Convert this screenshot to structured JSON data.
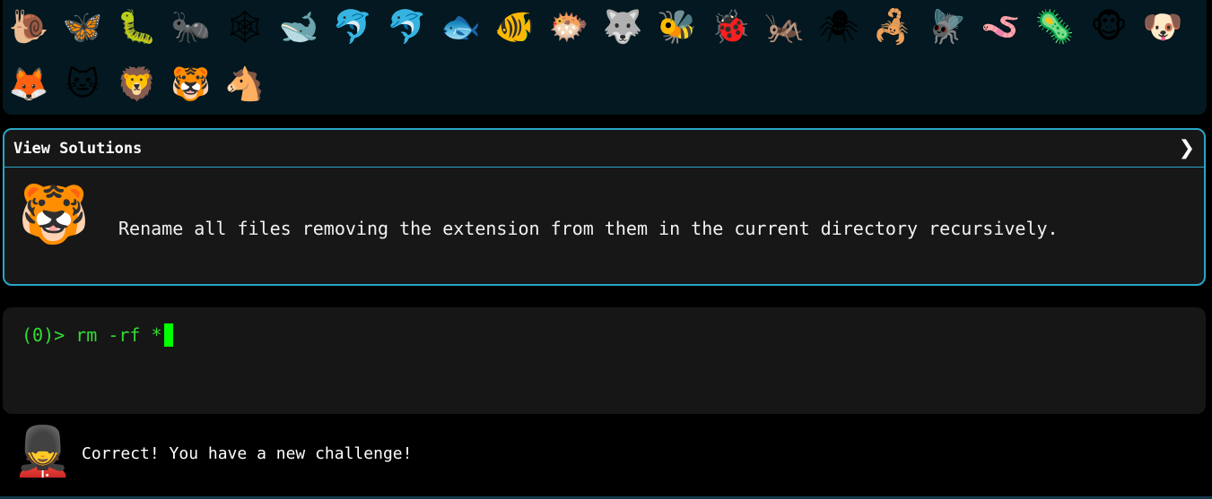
{
  "emoji_bar": {
    "row1": [
      {
        "glyph": "🐌",
        "name": "snail-icon"
      },
      {
        "glyph": "🦋",
        "name": "butterfly-icon"
      },
      {
        "glyph": "🐛",
        "name": "caterpillar-icon"
      },
      {
        "glyph": "🐜",
        "name": "ant-icon"
      },
      {
        "glyph": "🕸",
        "name": "spider-web-icon"
      },
      {
        "glyph": "🐋",
        "name": "whale-icon"
      },
      {
        "glyph": "🐬",
        "name": "dolphin-icon"
      },
      {
        "glyph": "🐬",
        "name": "dolphin-gray-icon"
      },
      {
        "glyph": "🐟",
        "name": "fish-icon"
      },
      {
        "glyph": "🐠",
        "name": "tropical-fish-icon"
      },
      {
        "glyph": "🐡",
        "name": "blowfish-icon"
      },
      {
        "glyph": "🐺",
        "name": "wolf-icon"
      },
      {
        "glyph": "🐝",
        "name": "bee-icon"
      },
      {
        "glyph": "🐞",
        "name": "ladybug-icon"
      },
      {
        "glyph": "🦗",
        "name": "cricket-icon"
      },
      {
        "glyph": "🕷",
        "name": "spider-icon"
      },
      {
        "glyph": "🦂",
        "name": "scorpion-icon"
      },
      {
        "glyph": "🪰",
        "name": "fly-icon"
      },
      {
        "glyph": "🪱",
        "name": "worm-icon"
      },
      {
        "glyph": "🦠",
        "name": "microbe-icon"
      },
      {
        "glyph": "🐵",
        "name": "monkey-icon"
      },
      {
        "glyph": "🐶",
        "name": "dog-icon"
      }
    ],
    "row2": [
      {
        "glyph": "🦊",
        "name": "fox-icon"
      },
      {
        "glyph": "🐱",
        "name": "cat-icon"
      },
      {
        "glyph": "🦁",
        "name": "lion-icon"
      },
      {
        "glyph": "🐯",
        "name": "tiger-icon"
      },
      {
        "glyph": "🐴",
        "name": "horse-icon"
      }
    ]
  },
  "solutions": {
    "title": "View Solutions",
    "chevron": "❯",
    "challenge_icon": "🐯",
    "challenge_text": "Rename all files removing the extension from them in the current directory recursively."
  },
  "terminal": {
    "prompt": "(0)> ",
    "command": "rm -rf *"
  },
  "feedback": {
    "icon": "💂",
    "message": "Correct! You have a new challenge!"
  }
}
